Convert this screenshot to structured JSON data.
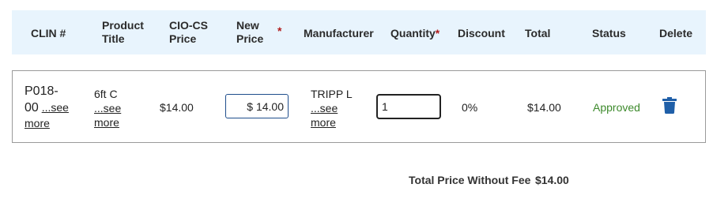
{
  "header": {
    "clin": "CLIN #",
    "product_title_1": "Product",
    "product_title_2": "Title",
    "ciocs_price_1": "CIO-CS",
    "ciocs_price_2": "Price",
    "new_price_1": "New",
    "new_price_2": "Price",
    "required_mark": "*",
    "manufacturer": "Manufacturer",
    "quantity": "Quantity",
    "discount": "Discount",
    "total": "Total",
    "status": "Status",
    "delete": "Delete"
  },
  "row": {
    "clin_line1": "P018-",
    "clin_line2": "00",
    "see_more_label": "...see",
    "more_label": "more",
    "product_title": "6ft C",
    "ciocs_price": "$14.00",
    "new_price_value": "$ 14.00",
    "manufacturer": "TRIPP L",
    "quantity_value": "1",
    "discount": "0%",
    "total": "$14.00",
    "status": "Approved",
    "delete_icon": "trash-icon"
  },
  "footer": {
    "label": "Total Price Without Fee",
    "value": "$14.00"
  },
  "colors": {
    "header_bg": "#e8f4fd",
    "required": "#b11d1d",
    "approved": "#3d8a2c",
    "trash": "#1f5fa8",
    "price_border": "#1f4e8c"
  }
}
